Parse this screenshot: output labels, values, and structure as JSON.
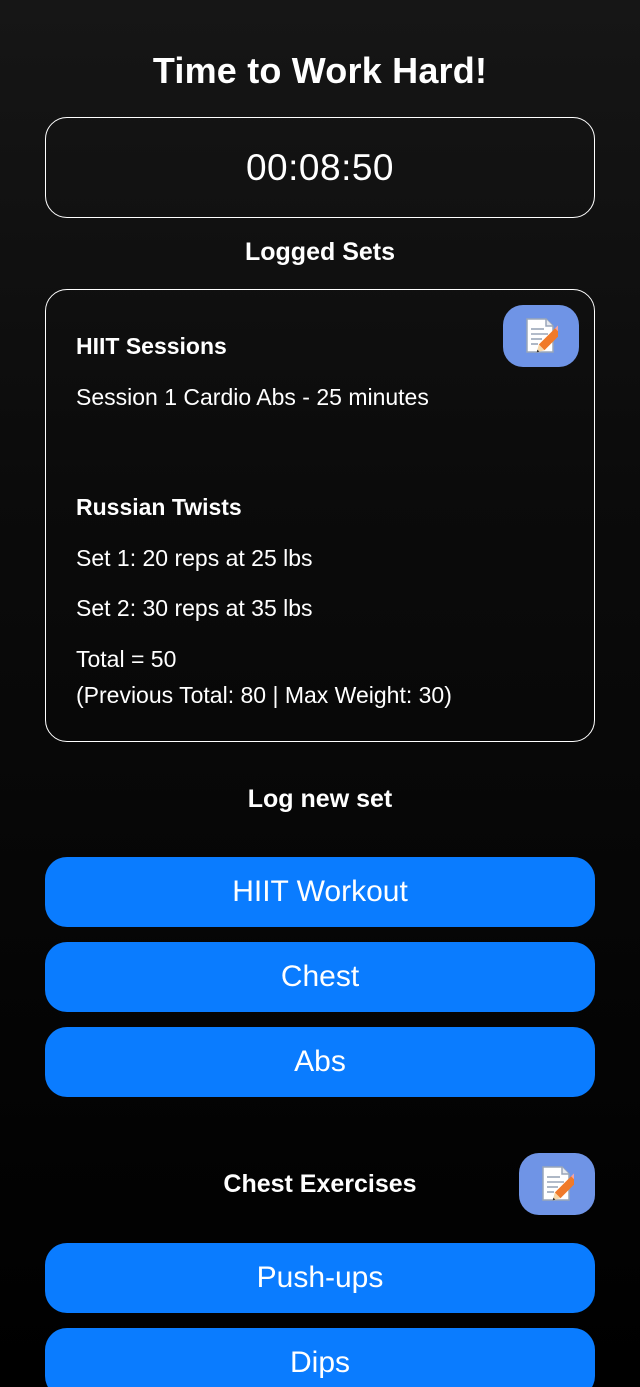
{
  "header": {
    "title": "Time to Work Hard!"
  },
  "timer": {
    "value": "00:08:50"
  },
  "logged_sets": {
    "heading": "Logged Sets",
    "lines": [
      "HIIT Sessions",
      "Session 1 Cardio Abs - 25 minutes",
      "Russian Twists",
      "Set 1: 20 reps at 25 lbs",
      "Set 2: 30 reps at 35 lbs",
      "Total = 50",
      "(Previous Total: 80 | Max Weight: 30)"
    ]
  },
  "log_new_set": {
    "heading": "Log new set",
    "buttons": [
      "HIIT Workout",
      "Chest",
      "Abs"
    ]
  },
  "chest_exercises": {
    "heading": "Chest Exercises",
    "buttons": [
      "Push-ups",
      "Dips"
    ]
  },
  "colors": {
    "button_blue": "#0a7cff",
    "edit_button": "#6f94e6"
  },
  "icons": {
    "edit": "memo-pencil-icon"
  }
}
